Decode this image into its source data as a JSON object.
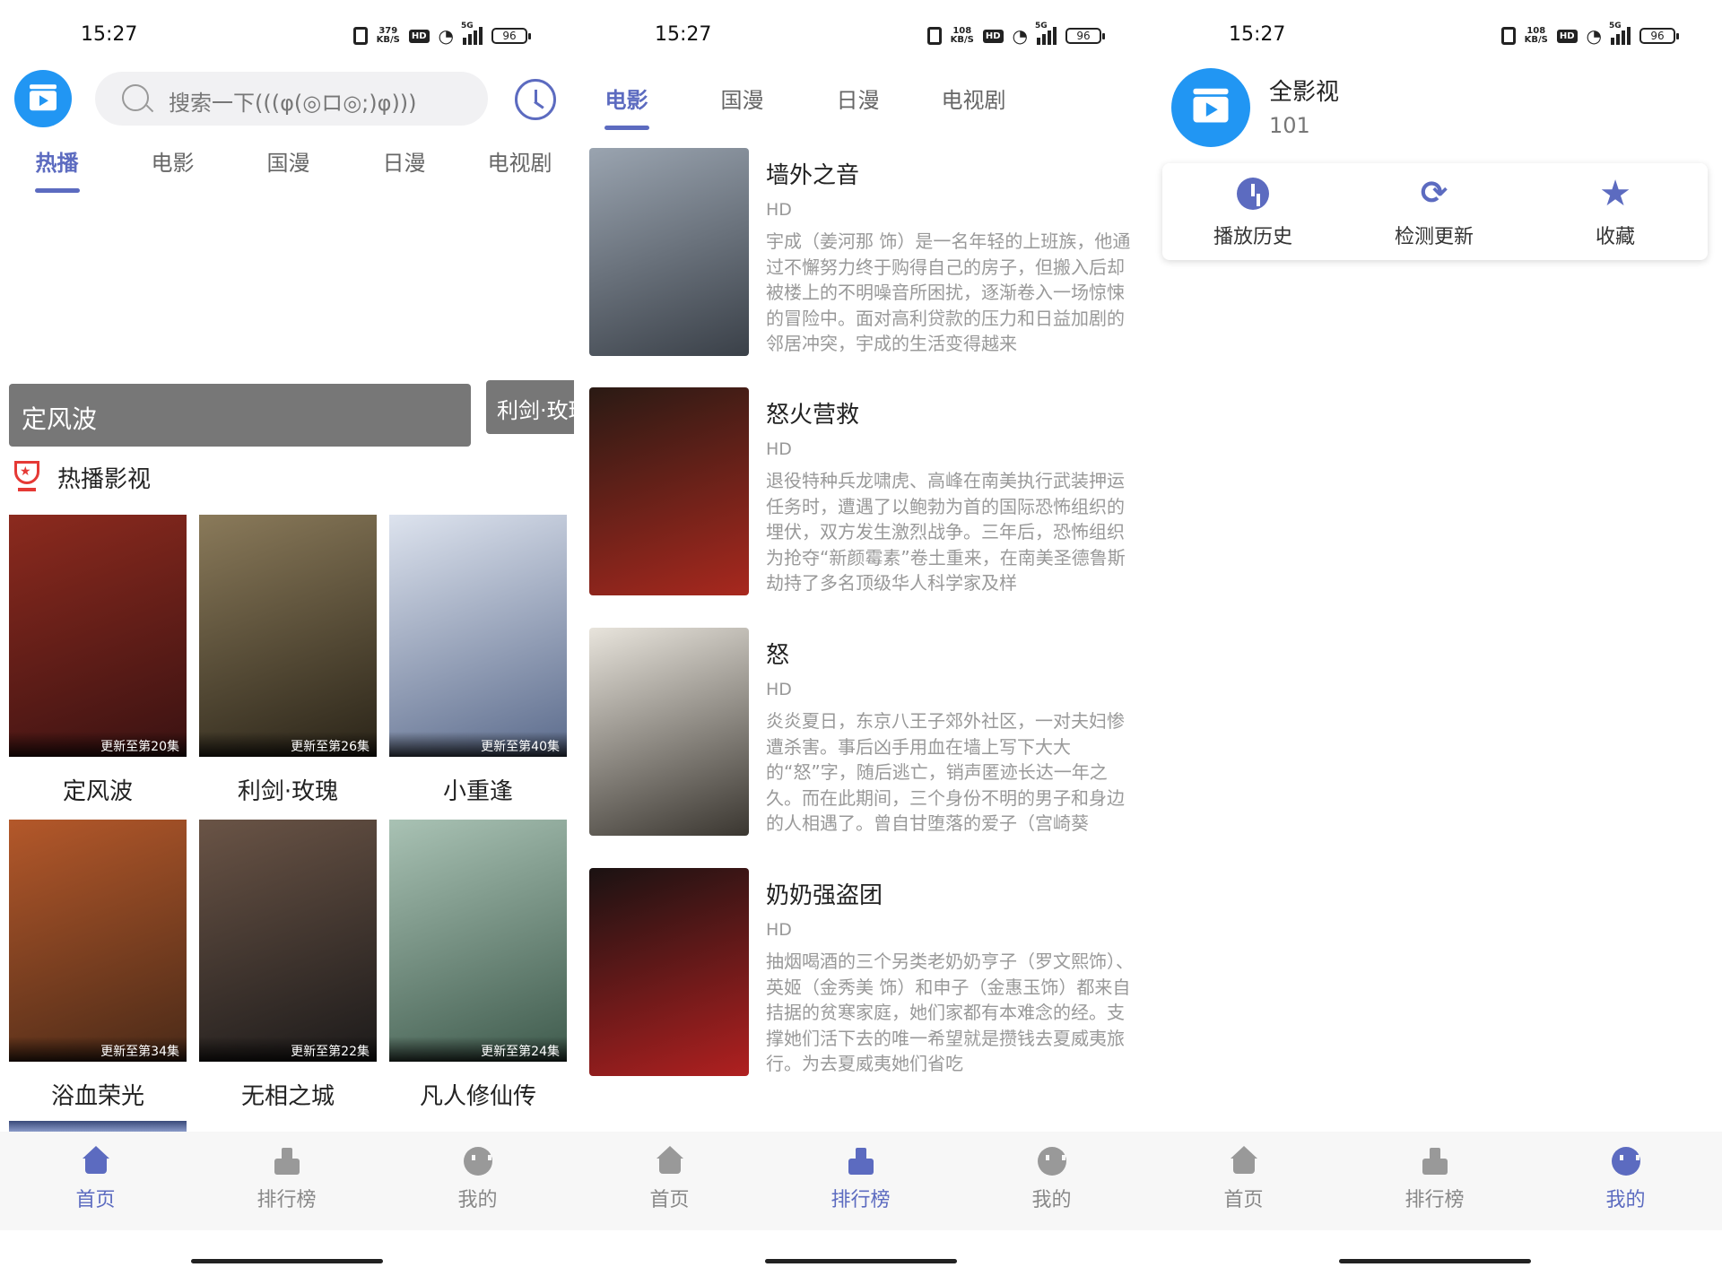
{
  "status": {
    "time": "15:27",
    "speed_1": "379",
    "speed_2": "108",
    "speed_3": "108",
    "speed_unit": "KB/S",
    "hd": "HD",
    "sig": "5G",
    "battery": "96"
  },
  "screen1": {
    "search_placeholder": "搜索一下(((φ(◎ロ◎;)φ)))",
    "tabs": [
      "热播",
      "电影",
      "国漫",
      "日漫",
      "电视剧"
    ],
    "banner_main": "定风波",
    "banner_next": "利剑·玫瑰",
    "section_title": "热播影视",
    "posters": [
      {
        "title": "定风波",
        "badge": "更新至第20集",
        "c1": "#3a1212",
        "c2": "#8c2a1e"
      },
      {
        "title": "利剑·玫瑰",
        "badge": "更新至第26集",
        "c1": "#2a2418",
        "c2": "#8a7a5a"
      },
      {
        "title": "小重逢",
        "badge": "更新至第40集",
        "c1": "#5b6b8c",
        "c2": "#dde3ee"
      },
      {
        "title": "浴血荣光",
        "badge": "更新至第34集",
        "c1": "#4a2a18",
        "c2": "#b4582a"
      },
      {
        "title": "无相之城",
        "badge": "更新至第22集",
        "c1": "#1c1a1a",
        "c2": "#6a5446"
      },
      {
        "title": "凡人修仙传",
        "badge": "更新至第24集",
        "c1": "#3e5a4c",
        "c2": "#a9c2b4"
      }
    ]
  },
  "screen2": {
    "tabs": [
      "电影",
      "国漫",
      "日漫",
      "电视剧"
    ],
    "movies": [
      {
        "title": "墙外之音",
        "quality": "HD",
        "desc": "宇成（姜河那 饰）是一名年轻的上班族，他通过不懈努力终于购得自己的房子，但搬入后却被楼上的不明噪音所困扰，逐渐卷入一场惊悚的冒险中。面对高利贷款的压力和日益加剧的邻居冲突，宇成的生活变得越来",
        "c1": "#9aa4b0",
        "c2": "#3a4048"
      },
      {
        "title": "怒火营救",
        "quality": "HD",
        "desc": "退役特种兵龙啸虎、高峰在南美执行武装押运任务时，遭遇了以鲍勃为首的国际恐怖组织的埋伏，双方发生激烈战争。三年后，恐怖组织为抢夺“新颜霉素”卷土重来，在南美圣德鲁斯劫持了多名顶级华人科学家及样",
        "c1": "#2a1a14",
        "c2": "#a8281e"
      },
      {
        "title": "怒",
        "quality": "HD",
        "desc": "炎炎夏日，东京八王子郊外社区，一对夫妇惨遭杀害。事后凶手用血在墙上写下大大的“怒”字，随后逃亡，销声匿迹长达一年之久。而在此期间，三个身份不明的男子和身边的人相遇了。曾自甘堕落的爱子（宫崎葵",
        "c1": "#e8e4dc",
        "c2": "#3a3630"
      },
      {
        "title": "奶奶强盗团",
        "quality": "HD",
        "desc": "抽烟喝酒的三个另类老奶奶亨子（罗文熙饰）、英姬（金秀美 饰）和申子（金惠玉饰）都来自拮据的贫寒家庭，她们家都有本难念的经。支撑她们活下去的唯一希望就是攒钱去夏威夷旅行。为去夏威夷她们省吃",
        "c1": "#1a1212",
        "c2": "#b02020"
      }
    ]
  },
  "screen3": {
    "app_name": "全影视",
    "version": "101",
    "actions": [
      "播放历史",
      "检测更新",
      "收藏"
    ]
  },
  "nav": {
    "home": "首页",
    "rank": "排行榜",
    "me": "我的"
  }
}
